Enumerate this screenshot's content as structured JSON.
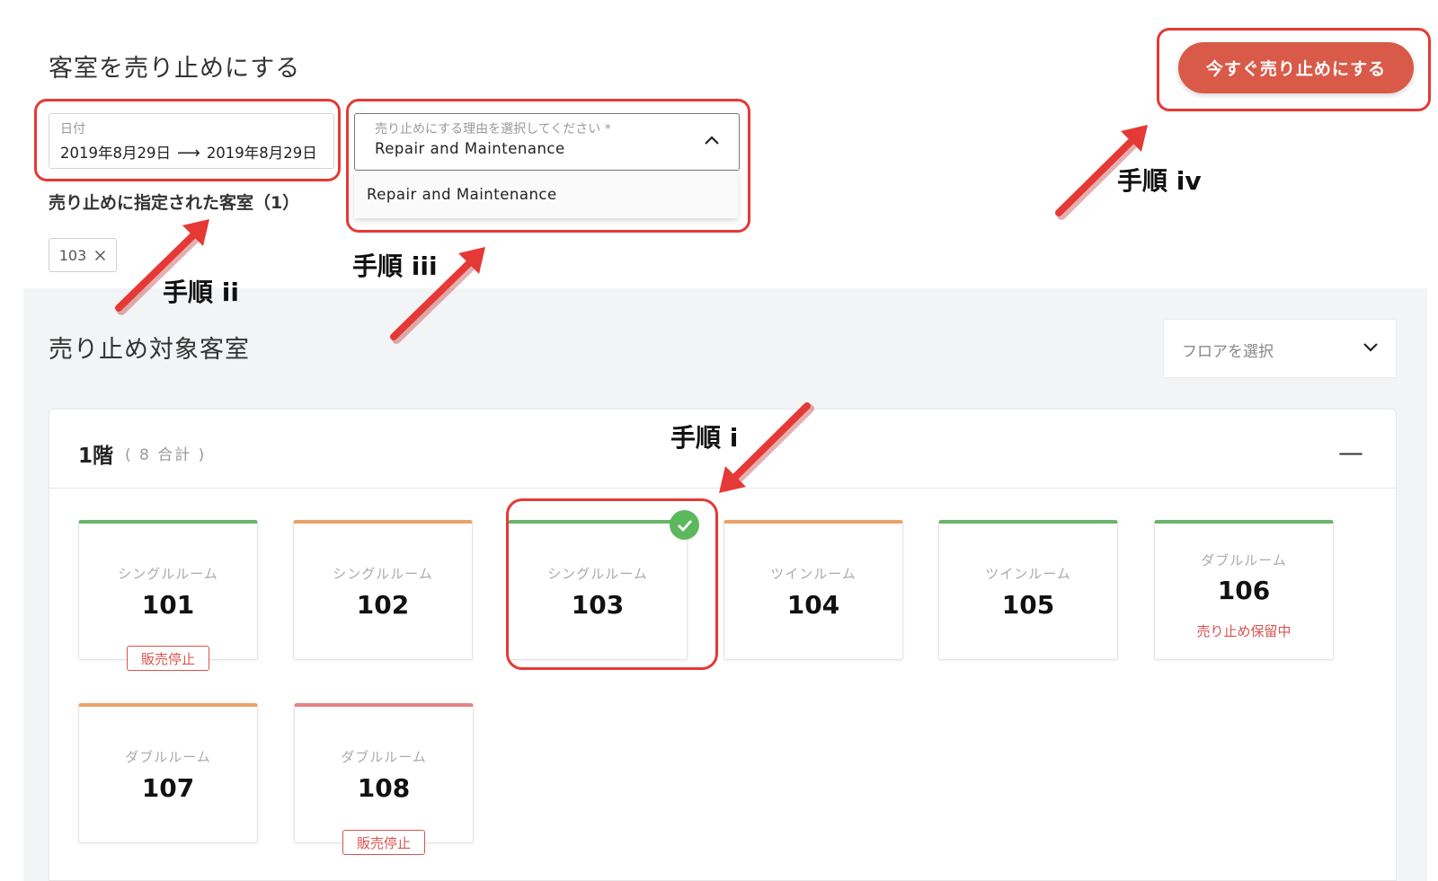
{
  "header": {
    "title": "客室を売り止めにする",
    "action_button": "今すぐ売り止めにする"
  },
  "date_field": {
    "label": "日付",
    "start": "2019年8月29日",
    "arrow": "⟶",
    "end": "2019年8月29日"
  },
  "reason": {
    "label": "売り止めにする理由を選択してください *",
    "value": "Repair and Maintenance",
    "options": [
      "Repair and Maintenance"
    ]
  },
  "selected_rooms": {
    "heading": "売り止めに指定された客室（1）",
    "chips": [
      {
        "label": "103",
        "remove_icon": "close-icon"
      }
    ]
  },
  "target_rooms": {
    "title": "売り止め対象客室",
    "floor_select_placeholder": "フロアを選択"
  },
  "floor": {
    "name": "1階",
    "count": "( 8 合計 )",
    "collapse_symbol": "—"
  },
  "rooms": [
    {
      "type": "シングルルーム",
      "number": "101",
      "badge": "販売停止",
      "status_color": "#6ab36a"
    },
    {
      "type": "シングルルーム",
      "number": "102",
      "status_color": "#e9a36b"
    },
    {
      "type": "シングルルーム",
      "number": "103",
      "selected": true,
      "status_color": "#6ab36a"
    },
    {
      "type": "ツインルーム",
      "number": "104",
      "status_color": "#e9a36b"
    },
    {
      "type": "ツインルーム",
      "number": "105",
      "status_color": "#6ab36a"
    },
    {
      "type": "ダブルルーム",
      "number": "106",
      "note": "売り止め保留中",
      "status_color": "#6ab36a"
    },
    {
      "type": "ダブルルーム",
      "number": "107",
      "status_color": "#e9a36b"
    },
    {
      "type": "ダブルルーム",
      "number": "108",
      "badge": "販売停止",
      "status_color": "#e58383"
    }
  ],
  "annotations": {
    "step_i": "手順 i",
    "step_ii": "手順 ii",
    "step_iii": "手順 iii",
    "step_iv": "手順 iv"
  },
  "colors": {
    "accent": "#d95a48",
    "annotation_red": "#e53935",
    "selected_check": "#5cb85c"
  }
}
